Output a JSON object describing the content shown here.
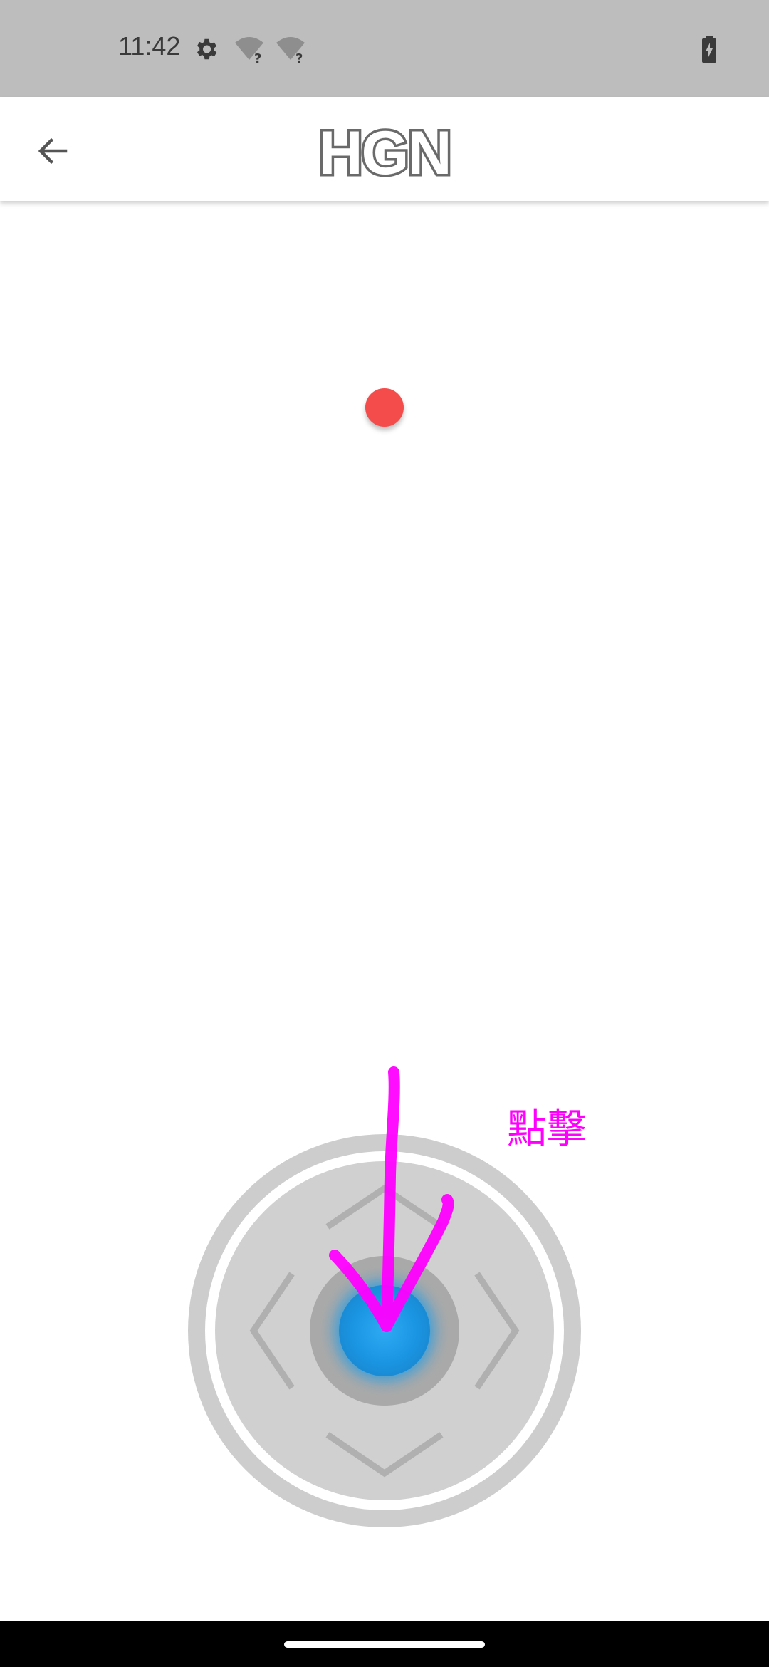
{
  "status_bar": {
    "time": "11:42",
    "icons": [
      "settings-icon",
      "wifi-unknown-icon",
      "wifi-unknown-icon",
      "battery-charging-icon"
    ]
  },
  "app_bar": {
    "back_icon": "arrow-back-icon",
    "title": "HGN"
  },
  "annotation": {
    "label": "點擊",
    "color": "#ff00ff"
  },
  "colors": {
    "status_bar": "#bdbdbd",
    "target_dot": "#f44b4b",
    "joystick_knob": "#1e9be6",
    "joystick_ring": "#cfcfcf"
  }
}
